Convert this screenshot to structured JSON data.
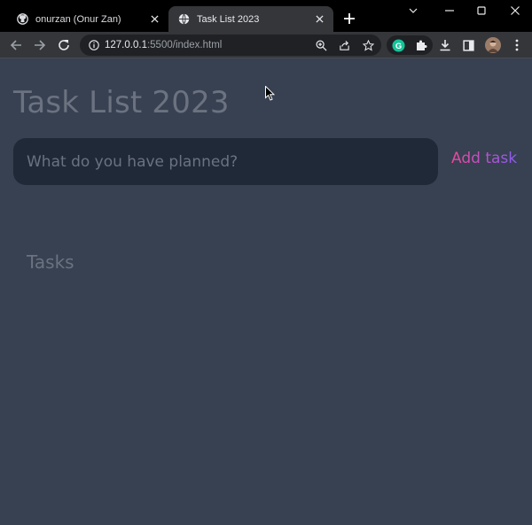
{
  "browser": {
    "tabs": [
      {
        "title": "onurzan (Onur Zan)",
        "icon": "github-icon",
        "active": false
      },
      {
        "title": "Task List 2023",
        "icon": "globe-icon",
        "active": true
      }
    ],
    "url": {
      "host": "127.0.0.1",
      "rest": ":5500/index.html"
    }
  },
  "page": {
    "title": "Task List 2023",
    "input": {
      "placeholder": "What do you have planned?",
      "value": ""
    },
    "add_button_label": "Add task",
    "section_title": "Tasks",
    "tasks": []
  },
  "colors": {
    "background": "#374151",
    "input_background": "#1f2937",
    "muted_text": "#6b7280",
    "accent_gradient_start": "#ec4899",
    "accent_gradient_end": "#8b5cf6"
  }
}
